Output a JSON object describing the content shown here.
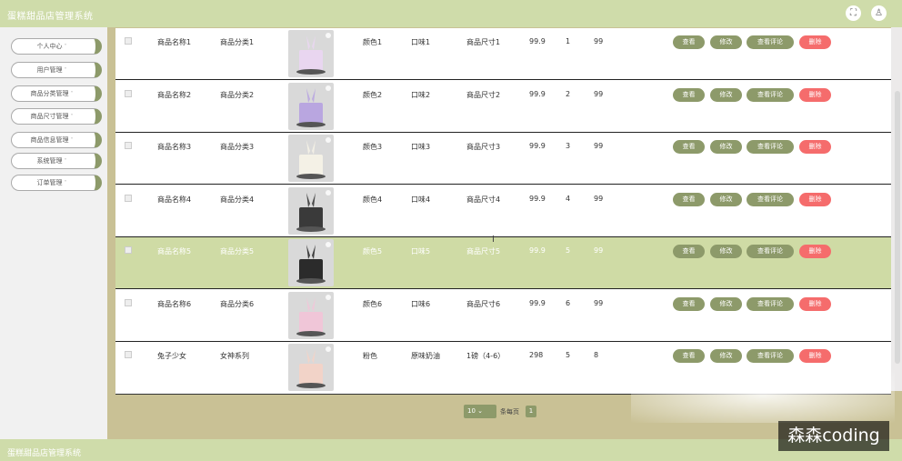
{
  "header": {
    "title": "蛋糕甜品店管理系统",
    "fullscreen_icon": "fullscreen-icon",
    "user_icon": "user-icon"
  },
  "sidebar": {
    "items": [
      {
        "label": "个人中心"
      },
      {
        "label": "用户管理"
      },
      {
        "label": "商品分类管理"
      },
      {
        "label": "商品尺寸管理"
      },
      {
        "label": "商品信息管理"
      },
      {
        "label": "系统管理"
      },
      {
        "label": "订单管理"
      }
    ],
    "arrow": "˅"
  },
  "actions": {
    "view": "查看",
    "edit": "修改",
    "review": "查看评论",
    "delete": "删除"
  },
  "rows": [
    {
      "name": "商品名称1",
      "category": "商品分类1",
      "color": "颜色1",
      "flavor": "口味1",
      "size": "商品尺寸1",
      "price": "99.9",
      "num": "1",
      "stock": "99",
      "img_accent": "#e9d6f0"
    },
    {
      "name": "商品名称2",
      "category": "商品分类2",
      "color": "颜色2",
      "flavor": "口味2",
      "size": "商品尺寸2",
      "price": "99.9",
      "num": "2",
      "stock": "99",
      "img_accent": "#b9a6e0"
    },
    {
      "name": "商品名称3",
      "category": "商品分类3",
      "color": "颜色3",
      "flavor": "口味3",
      "size": "商品尺寸3",
      "price": "99.9",
      "num": "3",
      "stock": "99",
      "img_accent": "#f4f1e6"
    },
    {
      "name": "商品名称4",
      "category": "商品分类4",
      "color": "颜色4",
      "flavor": "口味4",
      "size": "商品尺寸4",
      "price": "99.9",
      "num": "4",
      "stock": "99",
      "img_accent": "#3a3a3a"
    },
    {
      "name": "商品名称5",
      "category": "商品分类5",
      "color": "颜色5",
      "flavor": "口味5",
      "size": "商品尺寸5",
      "price": "99.9",
      "num": "5",
      "stock": "99",
      "img_accent": "#2b2b2b"
    },
    {
      "name": "商品名称6",
      "category": "商品分类6",
      "color": "颜色6",
      "flavor": "口味6",
      "size": "商品尺寸6",
      "price": "99.9",
      "num": "6",
      "stock": "99",
      "img_accent": "#f0c6d8"
    },
    {
      "name": "兔子少女",
      "category": "女神系列",
      "color": "粉色",
      "flavor": "原味奶油",
      "size": "1磅（4-6）",
      "price": "298",
      "num": "5",
      "stock": "8",
      "img_accent": "#f2d3c8"
    }
  ],
  "pagination": {
    "page_size": "10",
    "per_page_label": "条每页",
    "current_page": "1"
  },
  "footer": {
    "title": "蛋糕甜品店管理系统"
  },
  "watermark": "森森coding",
  "colors": {
    "accent": "#8d9a6a",
    "header_bg": "#cfdcaa",
    "danger": "#f56c6c",
    "highlight_row": "#cfdba5"
  }
}
